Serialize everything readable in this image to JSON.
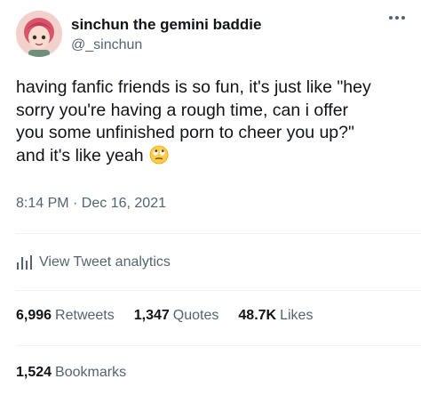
{
  "author": {
    "display_name": "sinchun the gemini baddie",
    "handle": "@_sinchun"
  },
  "tweet": {
    "lines": [
      "having fanfic friends is so fun, it's just like \"hey",
      "sorry you're having a rough time, can i offer",
      "you some unfinished porn to cheer you up?\"",
      "and it's like yeah"
    ],
    "emoji": "face-with-rolling-eyes-icon",
    "timestamp": "8:14 PM · Dec 16, 2021"
  },
  "analytics": {
    "label": "View Tweet analytics"
  },
  "stats": {
    "retweets_count": "6,996",
    "retweets_label": "Retweets",
    "quotes_count": "1,347",
    "quotes_label": "Quotes",
    "likes_count": "48.7K",
    "likes_label": "Likes",
    "bookmarks_count": "1,524",
    "bookmarks_label": "Bookmarks"
  },
  "colors": {
    "text_primary": "#0f1419",
    "text_secondary": "#536471",
    "divider": "#eff3f4"
  }
}
